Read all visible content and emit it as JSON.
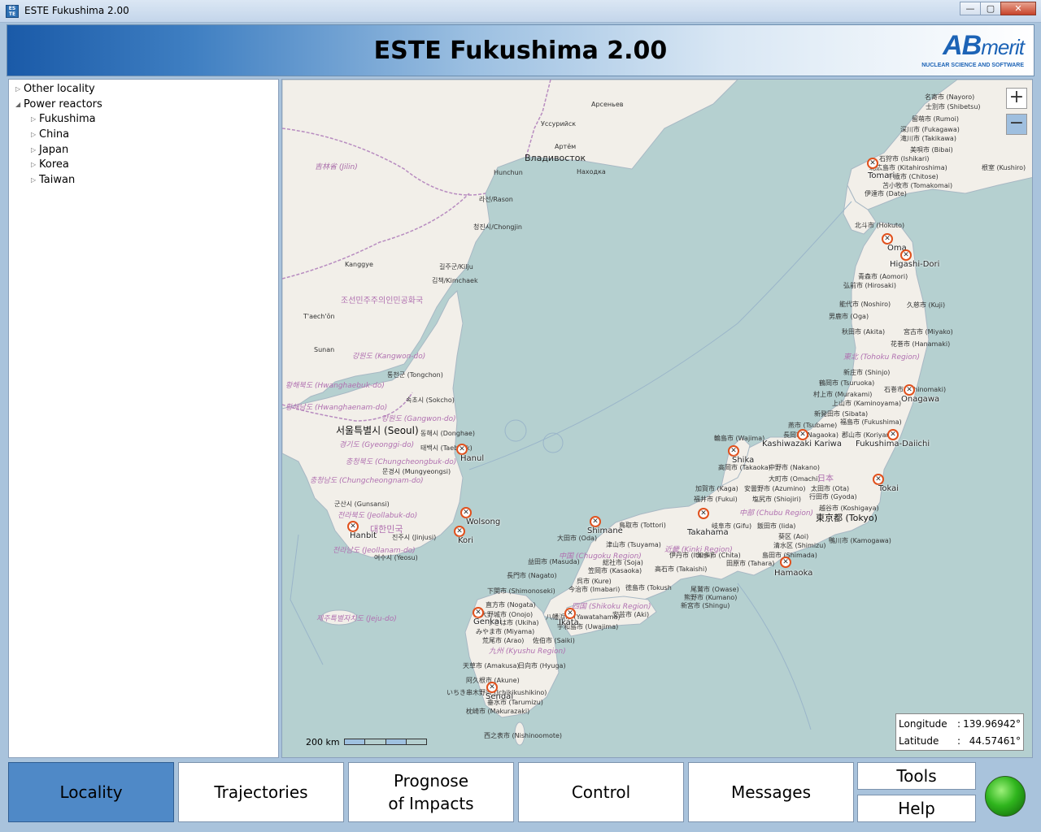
{
  "window": {
    "title": "ESTE Fukushima 2.00",
    "app_icon_text": "ES TE",
    "minimize": "—",
    "maximize": "▢",
    "close": "✕"
  },
  "header": {
    "title": "ESTE Fukushima 2.00",
    "logo_ab": "AB",
    "logo_merit": "merit",
    "logo_tagline": "NUCLEAR SCIENCE AND SOFTWARE"
  },
  "tree": {
    "other": "Other locality",
    "power_reactors": "Power reactors",
    "children": [
      "Fukushima",
      "China",
      "Japan",
      "Korea",
      "Taiwan"
    ]
  },
  "map": {
    "zoom_in": "+",
    "zoom_out": "−",
    "scale_label": "200 km",
    "coords": {
      "lon_label": "Longitude",
      "lon_value": "139.96942°",
      "lat_label": "Latitude",
      "lat_value": "44.57461°",
      "sep": ":"
    },
    "reactors": [
      "Tomari",
      "Oma",
      "Higashi-Dori",
      "Onagawa",
      "Fukushima-Daiichi",
      "Kashiwazaki Kariwa",
      "Shika",
      "Tokai",
      "Takahama",
      "Hamaoka",
      "Shimane",
      "Ikata",
      "Genkai",
      "Sendai",
      "Hanul",
      "Wolsong",
      "Kori",
      "Hanbit"
    ],
    "labels": {
      "seoul": "서울특별시 (Seoul)",
      "tokyo": "東京都 (Tokyo)",
      "vladivostok": "Владивосток",
      "arsenyevo": "Арсеньев",
      "ussuriysk": "Уссурийск",
      "artem": "Артём",
      "nakhodka": "Находка",
      "hunchun": "Hunchun",
      "rason": "라선/Rason",
      "chongjin": "청진시/Chongjin",
      "kilju": "길주군/Kilju",
      "kimchaek": "김책/Kimchaek",
      "kanggye": "Kanggye",
      "taechon": "T'aech'ŏn",
      "sunan": "Sunan",
      "dprk": "조선민주주의인민공화국",
      "korea": "대한민국",
      "kangwon": "강원도 (Kangwon-do)",
      "hwanghaebuk": "황해북도 (Hwanghaebuk-do)",
      "hwanghaenam": "황해남도 (Hwanghaenam-do)",
      "gangwon": "강원도 (Gangwon-do)",
      "gyeonggi": "경기도 (Gyeonggi-do)",
      "chungbuk": "충청북도 (Chungcheongbuk-do)",
      "chungnam": "충청남도 (Chungcheongnam-do)",
      "jeonbuk": "전라북도 (Jeollabuk-do)",
      "jeonnam": "전라남도 (Jeollanam-do)",
      "jeju": "제주특별자치도 (Jeju-do)",
      "tongchon": "통천군 (Tongchon)",
      "sokcho": "속초시 (Sokcho)",
      "donghae": "동해시 (Donghae)",
      "taebaek": "태백시 (Taebaek)",
      "mungyeong": "문경시 (Mungyeongsi)",
      "gunsan": "군산시 (Gunsansi)",
      "jinju": "진주시 (Jinjusi)",
      "yeosu": "여수시 (Yeosu)",
      "jilin": "吉林省 (Jilin)",
      "hokkaido_rumoi": "留萌市 (Rumoi)",
      "fukagawa": "深川市 (Fukagawa)",
      "takikawa": "滝川市 (Takikawa)",
      "bibai": "美唄市 (Bibai)",
      "ishikari": "石狩市 (Ishikari)",
      "kitahiroshima": "北広島市 (Kitahiroshima)",
      "chitose": "千歳市 (Chitose)",
      "tomakomai": "苫小牧市 (Tomakomai)",
      "date": "伊達市 (Date)",
      "nayoro": "名寄市 (Nayoro)",
      "shibetsu": "士別市 (Shibetsu)",
      "hokuto": "北斗市 (Hokuto)",
      "aomori": "青森市 (Aomori)",
      "hirosaki": "弘前市 (Hirosaki)",
      "kuji": "久慈市 (Kuji)",
      "noshiro": "能代市 (Noshiro)",
      "oga": "男鹿市 (Oga)",
      "akita": "秋田市 (Akita)",
      "miyako": "宮古市 (Miyako)",
      "hanamaki": "花巻市 (Hanamaki)",
      "tohoku": "東北 (Tohoku Region)",
      "shinjo": "新庄市 (Shinjo)",
      "tsuruoka": "鶴岡市 (Tsuruoka)",
      "ishinomaki": "石巻市 (Ishinomaki)",
      "murakami": "村上市 (Murakami)",
      "kaminoyama": "上山市 (Kaminoyama)",
      "sibata": "新発田市 (Sibata)",
      "fukushima_city": "福島市 (Fukushima)",
      "tsubame": "燕市 (Tsubame)",
      "nagaoka": "長岡市 (Nagaoka)",
      "koriyama": "郡山市 (Koriyama)",
      "wajima": "輪島市 (Wajima)",
      "takaoka": "高岡市 (Takaoka)",
      "nakano": "中野市 (Nakano)",
      "omachi": "大町市 (Omachi)",
      "kaga": "加賀市 (Kaga)",
      "fukui": "福井市 (Fukui)",
      "azumino": "安曇野市 (Azumino)",
      "shiojiri": "塩尻市 (Shiojiri)",
      "ota": "太田市 (Ota)",
      "gyoda": "行田市 (Gyoda)",
      "koshigaya": "越谷市 (Koshigaya)",
      "chubu": "中部 (Chubu Region)",
      "gifu": "岐阜市 (Gifu)",
      "iida": "飯田市 (Iida)",
      "aoi": "葵区 (Aoi)",
      "shimizu": "清水区 (Shimizu)",
      "shimada": "島田市 (Shimada)",
      "kamogawa": "鴨川市 (Kamogawa)",
      "tahara": "田原市 (Tahara)",
      "chita": "知多市 (Chita)",
      "kinki": "近畿 (Kinki Region)",
      "tottori": "鳥取市 (Tottori)",
      "oda": "大田市 (Oda)",
      "tsuyama": "津山市 (Tsuyama)",
      "chugoku": "中国 (Chugoku Region)",
      "soja": "総社市 (Soja)",
      "kasaoka": "笠岡市 (Kasaoka)",
      "masuda": "益田市 (Masuda)",
      "nagato": "長門市 (Nagato)",
      "kure": "呉市 (Kure)",
      "imabari": "今治市 (Imabari)",
      "shimonoseki": "下関市 (Shimonoseki)",
      "tokushima": "徳島市 (Tokush",
      "shikoku": "四国 (Shikoku Region)",
      "aki": "安芸市 (Aki)",
      "owase": "尾鷲市 (Owase)",
      "kumano": "熊野市 (Kumano)",
      "shingu": "新宮市 (Shingu)",
      "takaishi": "高石市 (Takaishi)",
      "itami": "伊丹市 (Itami)",
      "nogata": "直方市 (Nogata)",
      "onojo": "大野城市 (Onojo)",
      "ukiha": "うきは市 (Ukiha)",
      "miyama": "みやま市 (Miyama)",
      "arao": "荒尾市 (Arao)",
      "saiki": "佐伯市 (Saiki)",
      "kyushu": "九州 (Kyushu Region)",
      "hyuga": "日向市 (Hyuga)",
      "amakusa": "天草市 (Amakusa)",
      "akune": "阿久根市 (Akune)",
      "ichikikushikino": "いちき串木野市 (Ichikikushikino)",
      "tarumizu": "垂水市 (Tarumizu)",
      "makurazaki": "枕崎市 (Makurazaki)",
      "nishinoomote": "西之表市 (Nishinoomote)",
      "uwajima": "宇和島市 (Uwajima)",
      "yawatahama": "八幡浜市 (Yawatahama)",
      "kanagi": "根室 (Kushiro)",
      "japan": "日本"
    }
  },
  "nav": {
    "locality": "Locality",
    "trajectories": "Trajectories",
    "prognose_line1": "Prognose",
    "prognose_line2": "of Impacts",
    "control": "Control",
    "messages": "Messages",
    "tools": "Tools",
    "help": "Help"
  },
  "colors": {
    "active_button": "#4f89c7",
    "status_light": "#2fb51d",
    "sea": "#b5d0d0",
    "land": "#f2efe9"
  }
}
